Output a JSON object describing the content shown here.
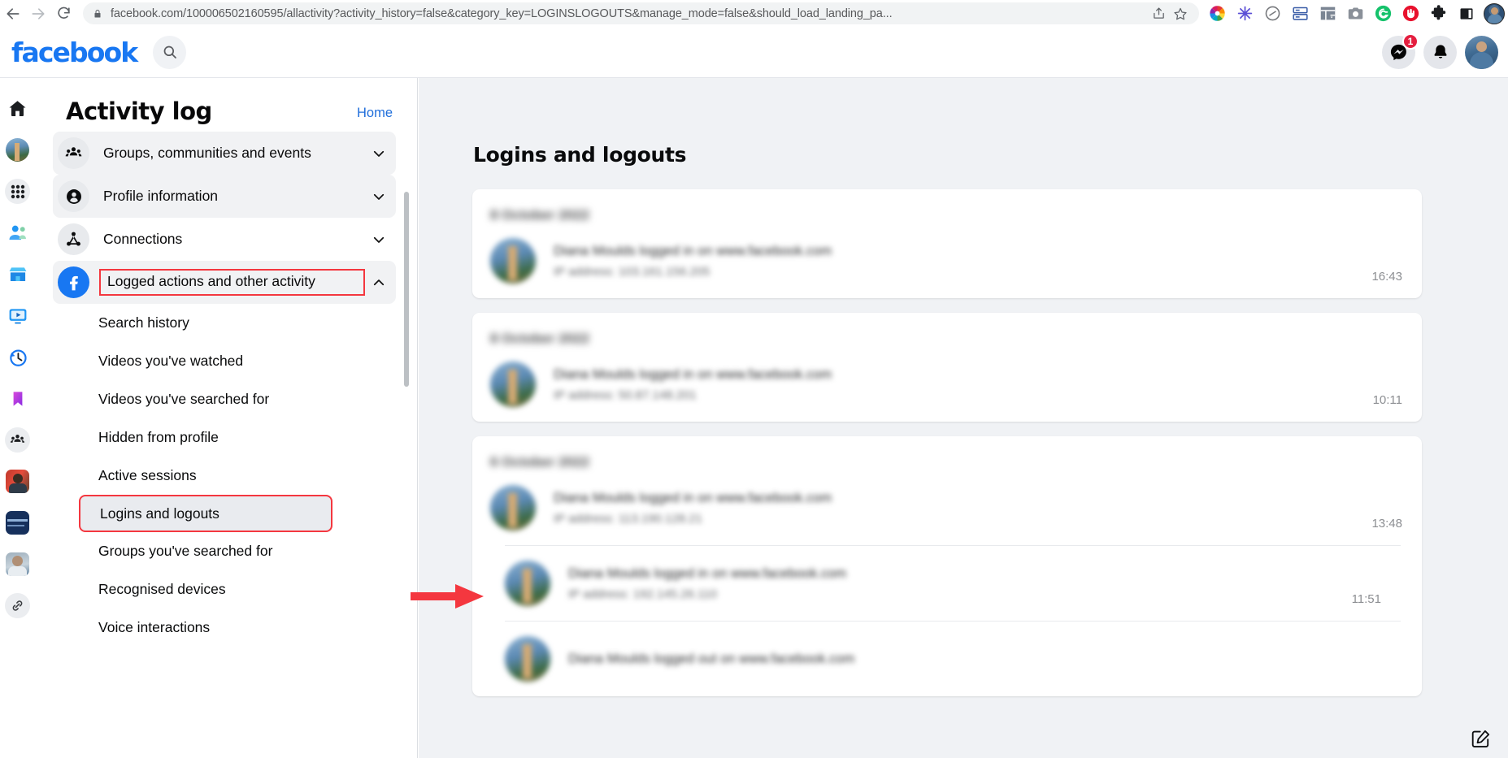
{
  "browser": {
    "back_icon": "back-arrow-icon",
    "forward_icon": "forward-arrow-icon",
    "reload_icon": "reload-icon",
    "lock_icon": "lock-icon",
    "url": "facebook.com/100006502160595/allactivity?activity_history=false&category_key=LOGINSLOGOUTS&manage_mode=false&should_load_landing_pa...",
    "share_icon": "share-icon",
    "bookmark_icon": "star-icon",
    "extensions": [
      "color-wheel-extension-icon",
      "asterisk-extension-icon",
      "slash-circle-extension-icon",
      "server-list-extension-icon",
      "table-extension-icon",
      "camera-extension-icon",
      "grammarly-extension-icon",
      "adblock-extension-icon",
      "puzzle-extensions-icon",
      "sidebar-panel-icon",
      "browser-profile-avatar"
    ]
  },
  "fb_header": {
    "logo": "facebook",
    "search_icon": "search-icon",
    "messenger_icon": "messenger-icon",
    "messenger_badge": "1",
    "notifications_icon": "bell-icon",
    "account_avatar": "account-avatar"
  },
  "left_rail": {
    "items": [
      {
        "name": "home-icon",
        "type": "icon"
      },
      {
        "name": "profile-avatar",
        "type": "photo-travel"
      },
      {
        "name": "menu-grid-icon",
        "type": "icon-circle"
      },
      {
        "name": "friends-icon",
        "type": "icon"
      },
      {
        "name": "marketplace-icon",
        "type": "icon"
      },
      {
        "name": "watch-video-icon",
        "type": "icon"
      },
      {
        "name": "memories-clock-icon",
        "type": "icon"
      },
      {
        "name": "saved-bookmark-icon",
        "type": "icon"
      },
      {
        "name": "groups-icon",
        "type": "icon-circle"
      },
      {
        "name": "shortcut-page-man-red",
        "type": "photo-red"
      },
      {
        "name": "shortcut-page-navy-banner",
        "type": "photo-navy"
      },
      {
        "name": "shortcut-page-elder-man",
        "type": "photo-elder"
      },
      {
        "name": "link-chain-icon",
        "type": "icon-circle"
      }
    ]
  },
  "sidebar": {
    "title": "Activity log",
    "home_link": "Home",
    "groups": [
      {
        "label": "Groups, communities and events",
        "icon": "group-people-icon",
        "expanded": false,
        "chevron": "chevron-down-icon",
        "shaded": true,
        "highlighted": false
      },
      {
        "label": "Profile information",
        "icon": "profile-person-icon",
        "expanded": false,
        "chevron": "chevron-down-icon",
        "shaded": true,
        "highlighted": false
      },
      {
        "label": "Connections",
        "icon": "connections-network-icon",
        "expanded": false,
        "chevron": "chevron-down-icon",
        "shaded": false,
        "highlighted": false
      },
      {
        "label": "Logged actions and other activity",
        "icon": "facebook-f-icon",
        "expanded": true,
        "chevron": "chevron-up-icon",
        "shaded": true,
        "highlighted": true
      }
    ],
    "sub_items": [
      {
        "label": "Search history",
        "selected": false
      },
      {
        "label": "Videos you've watched",
        "selected": false
      },
      {
        "label": "Videos you've searched for",
        "selected": false
      },
      {
        "label": "Hidden from profile",
        "selected": false
      },
      {
        "label": "Active sessions",
        "selected": false
      },
      {
        "label": "Logins and logouts",
        "selected": true
      },
      {
        "label": "Groups you've searched for",
        "selected": false
      },
      {
        "label": "Recognised devices",
        "selected": false
      },
      {
        "label": "Voice interactions",
        "selected": false
      }
    ]
  },
  "main": {
    "heading": "Logins and logouts",
    "cards": [
      {
        "date": "8 October 2022",
        "entries": [
          {
            "action": "Diana Moulds logged in on www.facebook.com",
            "detail": "IP address: 103.161.156.205",
            "time": "16:43"
          }
        ]
      },
      {
        "date": "8 October 2022",
        "entries": [
          {
            "action": "Diana Moulds logged in on www.facebook.com",
            "detail": "IP address: 50.87.148.201",
            "time": "10:11"
          }
        ]
      },
      {
        "date": "6 October 2022",
        "entries": [
          {
            "action": "Diana Moulds logged in on www.facebook.com",
            "detail": "IP address: 113.190.128.21",
            "time": "13:48"
          },
          {
            "action": "Diana Moulds logged in on www.facebook.com",
            "detail": "IP address: 192.145.26.110",
            "time": "11:51"
          },
          {
            "action": "Diana Moulds logged out on www.facebook.com",
            "detail": "",
            "time": ""
          }
        ]
      }
    ],
    "chat_composer_icon": "new-message-icon"
  },
  "annotations": {
    "arrow_color": "#f4373f",
    "box_color": "#f4373f",
    "arrow_points_to": "Logins and logouts"
  }
}
